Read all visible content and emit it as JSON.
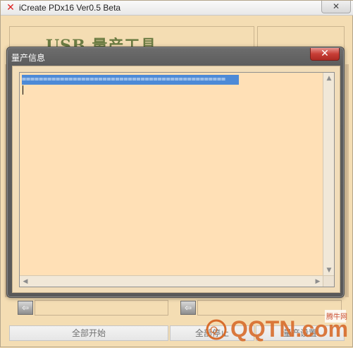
{
  "window": {
    "title": "iCreate PDx16 Ver0.5 Beta",
    "close_symbol": "✕",
    "app_icon_symbol": "✕"
  },
  "background": {
    "logo_text": "USB 量产工具"
  },
  "dialog": {
    "title": "量产信息",
    "close_symbol": "✕",
    "selected_text": "================================================",
    "caret_symbol": "|"
  },
  "bottom_buttons": [
    {
      "label": "全部开始"
    },
    {
      "label": "全部停止"
    },
    {
      "label": "量产设置"
    }
  ],
  "scrollbars": {
    "up_symbol": "▲",
    "down_symbol": "▼",
    "left_symbol": "◀",
    "right_symbol": "▶"
  },
  "icons": {
    "port_arrow_symbol": "⇦"
  },
  "watermark": {
    "text": "QQTN.com",
    "subtext": "腾牛网",
    "color": "#d86c2c"
  }
}
